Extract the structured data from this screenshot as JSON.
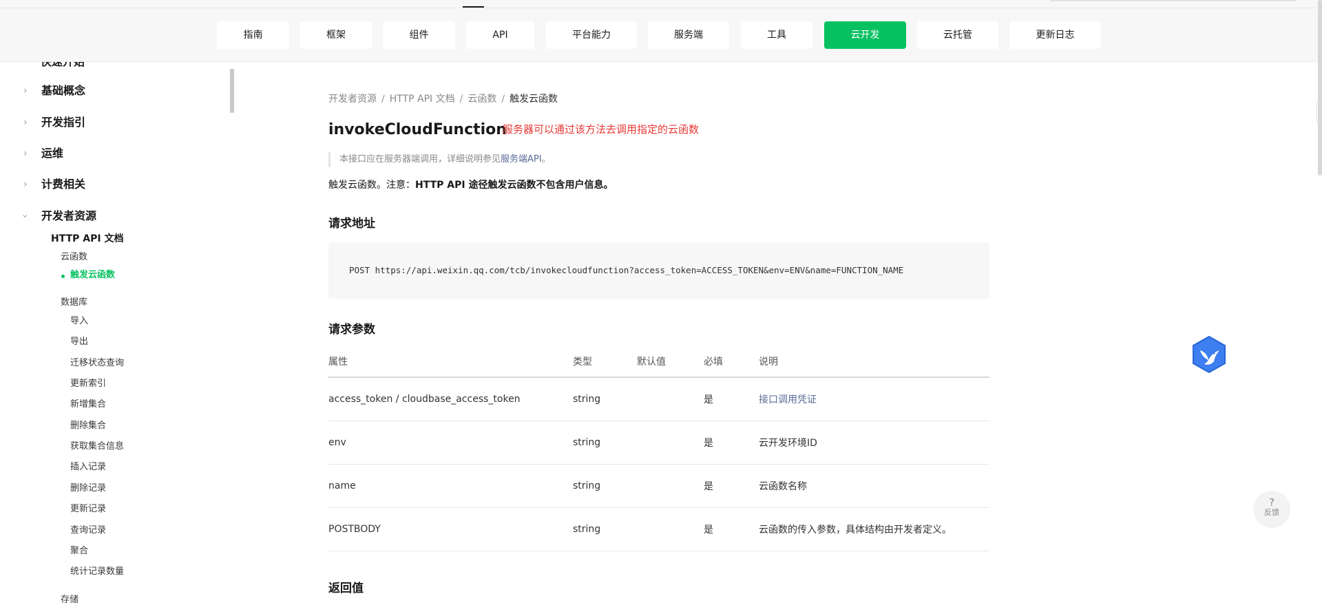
{
  "nav": {
    "items": [
      {
        "label": "指南"
      },
      {
        "label": "框架"
      },
      {
        "label": "组件"
      },
      {
        "label": "API"
      },
      {
        "label": "平台能力"
      },
      {
        "label": "服务端"
      },
      {
        "label": "工具"
      },
      {
        "label": "云开发",
        "active": true
      },
      {
        "label": "云托管"
      },
      {
        "label": "更新日志"
      }
    ]
  },
  "sidebar": {
    "cut_label": "快速开始",
    "top": [
      {
        "label": "基础概念",
        "expanded": false
      },
      {
        "label": "开发指引",
        "expanded": false
      },
      {
        "label": "运维",
        "expanded": false
      },
      {
        "label": "计费相关",
        "expanded": false
      },
      {
        "label": "开发者资源",
        "expanded": true
      }
    ],
    "section": "HTTP API 文档",
    "group_cloudfunc": "云函数",
    "active_item": "触发云函数",
    "group_db": "数据库",
    "db_items": [
      "导入",
      "导出",
      "迁移状态查询",
      "更新索引",
      "新增集合",
      "删除集合",
      "获取集合信息",
      "插入记录",
      "删除记录",
      "更新记录",
      "查询记录",
      "聚合",
      "统计记录数量"
    ],
    "group_storage": "存储"
  },
  "breadcrumb": {
    "items": [
      "开发者资源",
      "HTTP API 文档",
      "云函数"
    ],
    "current": "触发云函数"
  },
  "page": {
    "title": "invokeCloudFunction",
    "title_note": "服务器可以通过该方法去调用指定的云函数",
    "quote_prefix": "本接口应在服务器端调用，详细说明参见",
    "quote_link": "服务端API",
    "quote_suffix": "。",
    "desc_prefix": "触发云函数。注意：",
    "desc_bold": "HTTP API 途径触发云函数不包含用户信息。",
    "section_url": "请求地址",
    "request_url": "POST https://api.weixin.qq.com/tcb/invokecloudfunction?access_token=ACCESS_TOKEN&env=ENV&name=FUNCTION_NAME",
    "section_params": "请求参数",
    "section_return": "返回值"
  },
  "params_table": {
    "headers": [
      "属性",
      "类型",
      "默认值",
      "必填",
      "说明"
    ],
    "rows": [
      {
        "name": "access_token / cloudbase_access_token",
        "type": "string",
        "default": "",
        "required": "是",
        "desc": "接口调用凭证",
        "desc_is_link": true
      },
      {
        "name": "env",
        "type": "string",
        "default": "",
        "required": "是",
        "desc": "云开发环境ID",
        "desc_is_link": false
      },
      {
        "name": "name",
        "type": "string",
        "default": "",
        "required": "是",
        "desc": "云函数名称",
        "desc_is_link": false
      },
      {
        "name": "POSTBODY",
        "type": "string",
        "default": "",
        "required": "是",
        "desc": "云函数的传入参数，具体结构由开发者定义。",
        "desc_is_link": false
      }
    ]
  },
  "help": {
    "icon": "?",
    "label": "反馈"
  },
  "colors": {
    "accent": "#07c160",
    "link": "#576b95",
    "note": "#e53935"
  }
}
